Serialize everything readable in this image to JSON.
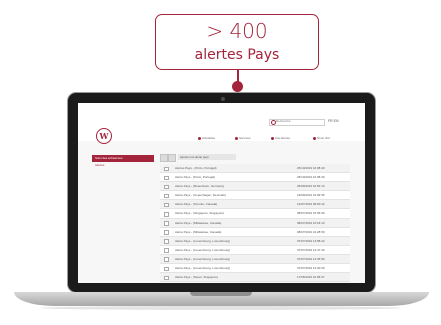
{
  "callout": {
    "count": "> 400",
    "label": "alertes Pays",
    "accent": "#a3243b"
  },
  "header": {
    "logo_letter": "W",
    "search_placeholder": "Recherche",
    "lang": "FR  EN",
    "nav": [
      {
        "label": "Actualités",
        "icon": "dot-icon"
      },
      {
        "label": "Services",
        "icon": "dot-icon"
      },
      {
        "label": "Vos Alertes",
        "icon": "dot-icon"
      },
      {
        "label": "Nous Voir",
        "icon": "dot-icon"
      }
    ]
  },
  "sidebar": {
    "active": "Suivi des échéances",
    "items": [
      "Alertes"
    ]
  },
  "toolbar": {
    "add_label": "Ajouter une alerte pays"
  },
  "alerts": [
    {
      "name": "Alertes Pays - (Porto, Portugal)",
      "date": "25/10/2019 10:08:40"
    },
    {
      "name": "Alerte Pays - (Porto, Portugal)",
      "date": "25/10/2019 10:08:40"
    },
    {
      "name": "Alerte Pays - (Rosenheim, Germany)",
      "date": "25/09/2019 10:52:14"
    },
    {
      "name": "Alerte Pays - (Copenhagen, Denmark)",
      "date": "19/09/2019 16:09:35"
    },
    {
      "name": "Alerte Pays - (Toronto, Canada)",
      "date": "12/07/2019 09:00:42"
    },
    {
      "name": "Alerte Pays - (Singapore, Singapore)",
      "date": "08/07/2019 15:09:39"
    },
    {
      "name": "Alerte Pays - (Milwaukee, Canada)",
      "date": "08/07/2019 10:18:13"
    },
    {
      "name": "Alerte Pays - (Milwaukee, Canada)",
      "date": "08/07/2019 10:28:59"
    },
    {
      "name": "Alerte Pays - (Luxembourg, Luxembourg)",
      "date": "07/07/2019 14:58:42"
    },
    {
      "name": "Alerte Pays - (Luxembourg, Luxembourg)",
      "date": "07/07/2019 14:47:30"
    },
    {
      "name": "Alerte Pays - (Luxembourg, Luxembourg)",
      "date": "07/07/2019 14:36:56"
    },
    {
      "name": "Alerte Pays - (Luxembourg, Luxembourg)",
      "date": "07/07/2019 14:30:09"
    },
    {
      "name": "Alerte Pays - (Seoul, Singapore)",
      "date": "17/06/2019 10:08:37"
    }
  ]
}
